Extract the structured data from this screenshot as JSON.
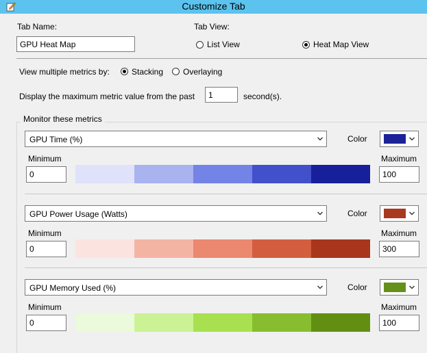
{
  "window": {
    "title": "Customize Tab"
  },
  "tab_name": {
    "label": "Tab Name:",
    "value": "GPU Heat Map"
  },
  "tab_view": {
    "label": "Tab View:",
    "options": [
      "List View",
      "Heat Map View"
    ],
    "selected": "Heat Map View"
  },
  "view_multiple": {
    "label": "View multiple metrics by:",
    "options": [
      "Stacking",
      "Overlaying"
    ],
    "selected": "Stacking"
  },
  "display_max": {
    "label": "Display the maximum metric value from the past",
    "value": "1",
    "unit": "second(s)."
  },
  "monitor_group": {
    "label": "Monitor these metrics"
  },
  "labels": {
    "color": "Color",
    "minimum": "Minimum",
    "maximum": "Maximum"
  },
  "metrics": [
    {
      "name": "GPU Time (%)",
      "color": "#1c2297",
      "min": "0",
      "max": "100",
      "ramp": [
        "#dfe2fa",
        "#a9b3f0",
        "#7383e6",
        "#4250cc",
        "#171f9b"
      ]
    },
    {
      "name": "GPU Power Usage (Watts)",
      "color": "#a83820",
      "min": "0",
      "max": "300",
      "ramp": [
        "#fbe4df",
        "#f4b4a4",
        "#ea8870",
        "#d35e3f",
        "#a8351c"
      ]
    },
    {
      "name": "GPU Memory Used (%)",
      "color": "#66901a",
      "min": "0",
      "max": "100",
      "ramp": [
        "#eafada",
        "#ccf296",
        "#a8e050",
        "#88bd30",
        "#628f12"
      ]
    }
  ]
}
